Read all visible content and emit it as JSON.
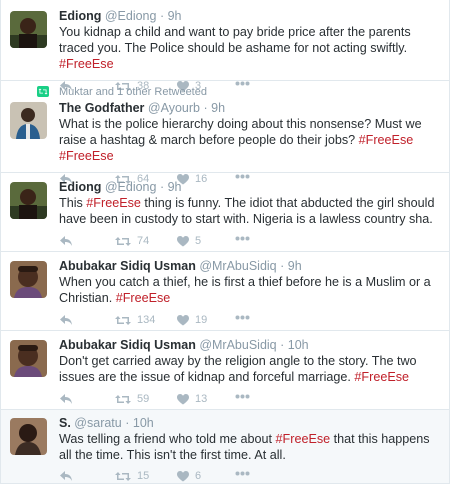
{
  "colors": {
    "hashtag": "#c0202a",
    "muted": "#8899a6",
    "icon": "#aab8c2",
    "retweet_badge": "#19cf86"
  },
  "tweets": [
    {
      "name": "Ediong",
      "handle": "@Ediong",
      "dot": "·",
      "time": "9h",
      "text_parts": [
        "You kidnap a child and want to pay bride price after the parents traced you. The Police should be ashame for not acting swiftly. ",
        "#FreeEse"
      ],
      "retweets": "38",
      "likes": "3"
    },
    {
      "context": "Muktar and 1 other Retweeted",
      "name": "The Godfather",
      "handle": "@Ayourb",
      "dot": "·",
      "time": "9h",
      "text_parts": [
        "What is the police hierarchy doing about this nonsense? Must we raise a hashtag & march before people do their jobs? ",
        "#FreeEse",
        " ",
        "#FreeEse"
      ],
      "retweets": "64",
      "likes": "16"
    },
    {
      "name": "Ediong",
      "handle": "@Ediong",
      "dot": "·",
      "time": "9h",
      "text_parts": [
        "This ",
        "#FreeEse",
        " thing is funny. The idiot that abducted the girl should have been in custody to start with. Nigeria is a lawless country sha."
      ],
      "retweets": "74",
      "likes": "5"
    },
    {
      "name": "Abubakar Sidiq Usman",
      "handle": "@MrAbuSidiq",
      "dot": "·",
      "time": "9h",
      "text_parts": [
        "When you catch a thief, he is first a thief before he is a Muslim or a Christian. ",
        "#FreeEse"
      ],
      "retweets": "134",
      "likes": "19"
    },
    {
      "name": "Abubakar Sidiq Usman",
      "handle": "@MrAbuSidiq",
      "dot": "·",
      "time": "10h",
      "text_parts": [
        "Don't get carried away by the religion angle to the story. The two issues are the issue of kidnap and forceful marriage. ",
        "#FreeEse"
      ],
      "retweets": "59",
      "likes": "13"
    },
    {
      "name": "S.",
      "handle": "@saratu",
      "dot": "·",
      "time": "10h",
      "text_parts": [
        "Was telling a friend who told me about ",
        "#FreeEse",
        " that this happens all the time. This isn't the first time. At all."
      ],
      "retweets": "15",
      "likes": "6"
    }
  ]
}
